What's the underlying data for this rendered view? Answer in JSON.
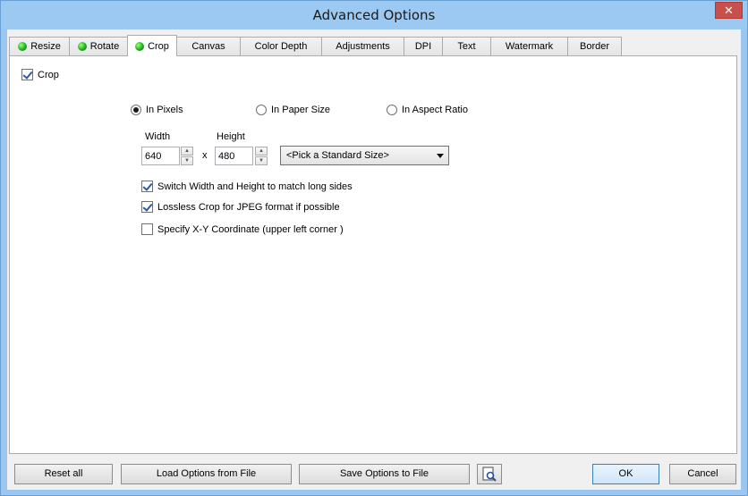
{
  "window": {
    "title": "Advanced Options",
    "close_label": "✕"
  },
  "tabs": [
    {
      "label": "Resize",
      "indicator": true
    },
    {
      "label": "Rotate",
      "indicator": true
    },
    {
      "label": "Crop",
      "indicator": true,
      "active": true
    },
    {
      "label": "Canvas"
    },
    {
      "label": "Color Depth"
    },
    {
      "label": "Adjustments"
    },
    {
      "label": "DPI"
    },
    {
      "label": "Text"
    },
    {
      "label": "Watermark"
    },
    {
      "label": "Border"
    }
  ],
  "crop": {
    "enable_label": "Crop",
    "enable_checked": true,
    "modes": [
      {
        "label": "In Pixels",
        "checked": true
      },
      {
        "label": "In Paper Size",
        "checked": false
      },
      {
        "label": "In Aspect Ratio",
        "checked": false
      }
    ],
    "width_label": "Width",
    "height_label": "Height",
    "width_value": "640",
    "height_value": "480",
    "times_label": "x",
    "standard_size": "<Pick a Standard Size>",
    "options": [
      {
        "label": "Switch Width and Height to match long sides",
        "checked": true
      },
      {
        "label": "Lossless Crop for JPEG format if possible",
        "checked": true
      },
      {
        "label": "Specify X-Y Coordinate (upper left corner )",
        "checked": false
      }
    ]
  },
  "footer": {
    "reset_label": "Reset all",
    "load_label": "Load Options from File",
    "save_label": "Save Options to File",
    "ok_label": "OK",
    "cancel_label": "Cancel"
  }
}
